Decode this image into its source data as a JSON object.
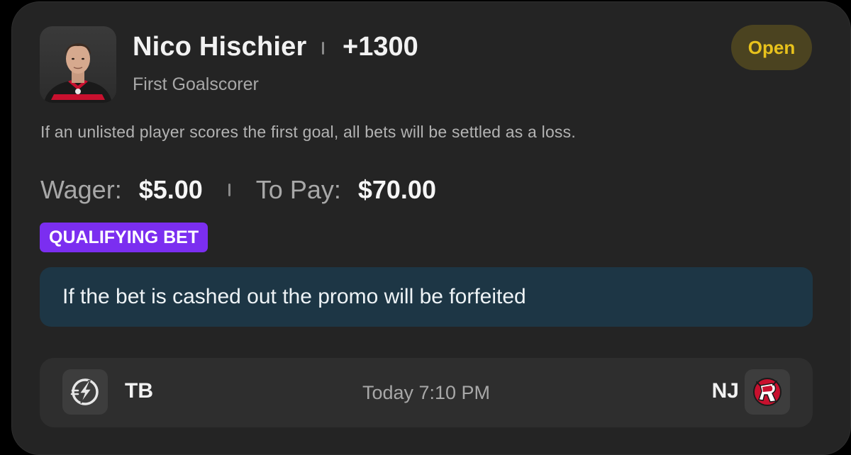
{
  "bet": {
    "player_name": "Nico Hischier",
    "odds": "+1300",
    "market": "First Goalscorer",
    "status": "Open",
    "rules_note": "If an unlisted player scores the first goal, all bets will be settled as a loss.",
    "wager_label": "Wager:",
    "wager_amount": "$5.00",
    "to_pay_label": "To Pay:",
    "to_pay_amount": "$70.00",
    "qualifying_badge": "QUALIFYING BET",
    "promo_notice": "If the bet is cashed out the promo will be forfeited"
  },
  "game": {
    "away_team": "TB",
    "away_logo_icon": "lightning-bolt-icon",
    "time": "Today 7:10 PM",
    "home_team": "NJ",
    "home_logo_icon": "devils-logo-icon"
  },
  "colors": {
    "card_bg": "#242424",
    "status_text": "#e8c21c",
    "status_bg": "#4b4320",
    "qualifying_bg": "#7b2ef0",
    "promo_bg": "#1d3645",
    "devils_red": "#c8102e"
  }
}
